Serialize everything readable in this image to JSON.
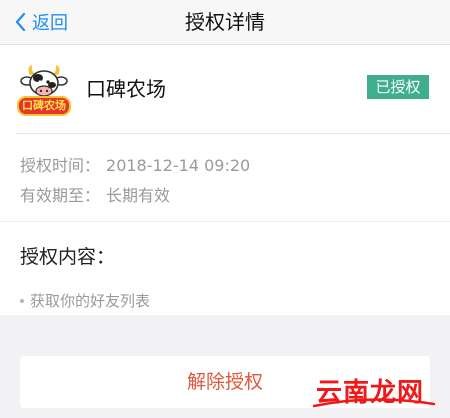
{
  "nav": {
    "back_label": "返回",
    "title": "授权详情"
  },
  "app": {
    "name": "口碑农场",
    "logo_text": "口碑农场",
    "status": "已授权",
    "status_color": "#3fae8e"
  },
  "info": {
    "time_label": "授权时间：",
    "time_value": "2018-12-14 09:20",
    "valid_label": "有效期至：",
    "valid_value": "长期有效"
  },
  "permissions": {
    "title": "授权内容：",
    "items": [
      "获取你的好友列表"
    ]
  },
  "actions": {
    "revoke_label": "解除授权",
    "revoke_color": "#e0573c"
  },
  "watermark": {
    "text": "云南龙网"
  },
  "colors": {
    "accent": "#1f8ef1",
    "background": "#f2f2f4"
  }
}
